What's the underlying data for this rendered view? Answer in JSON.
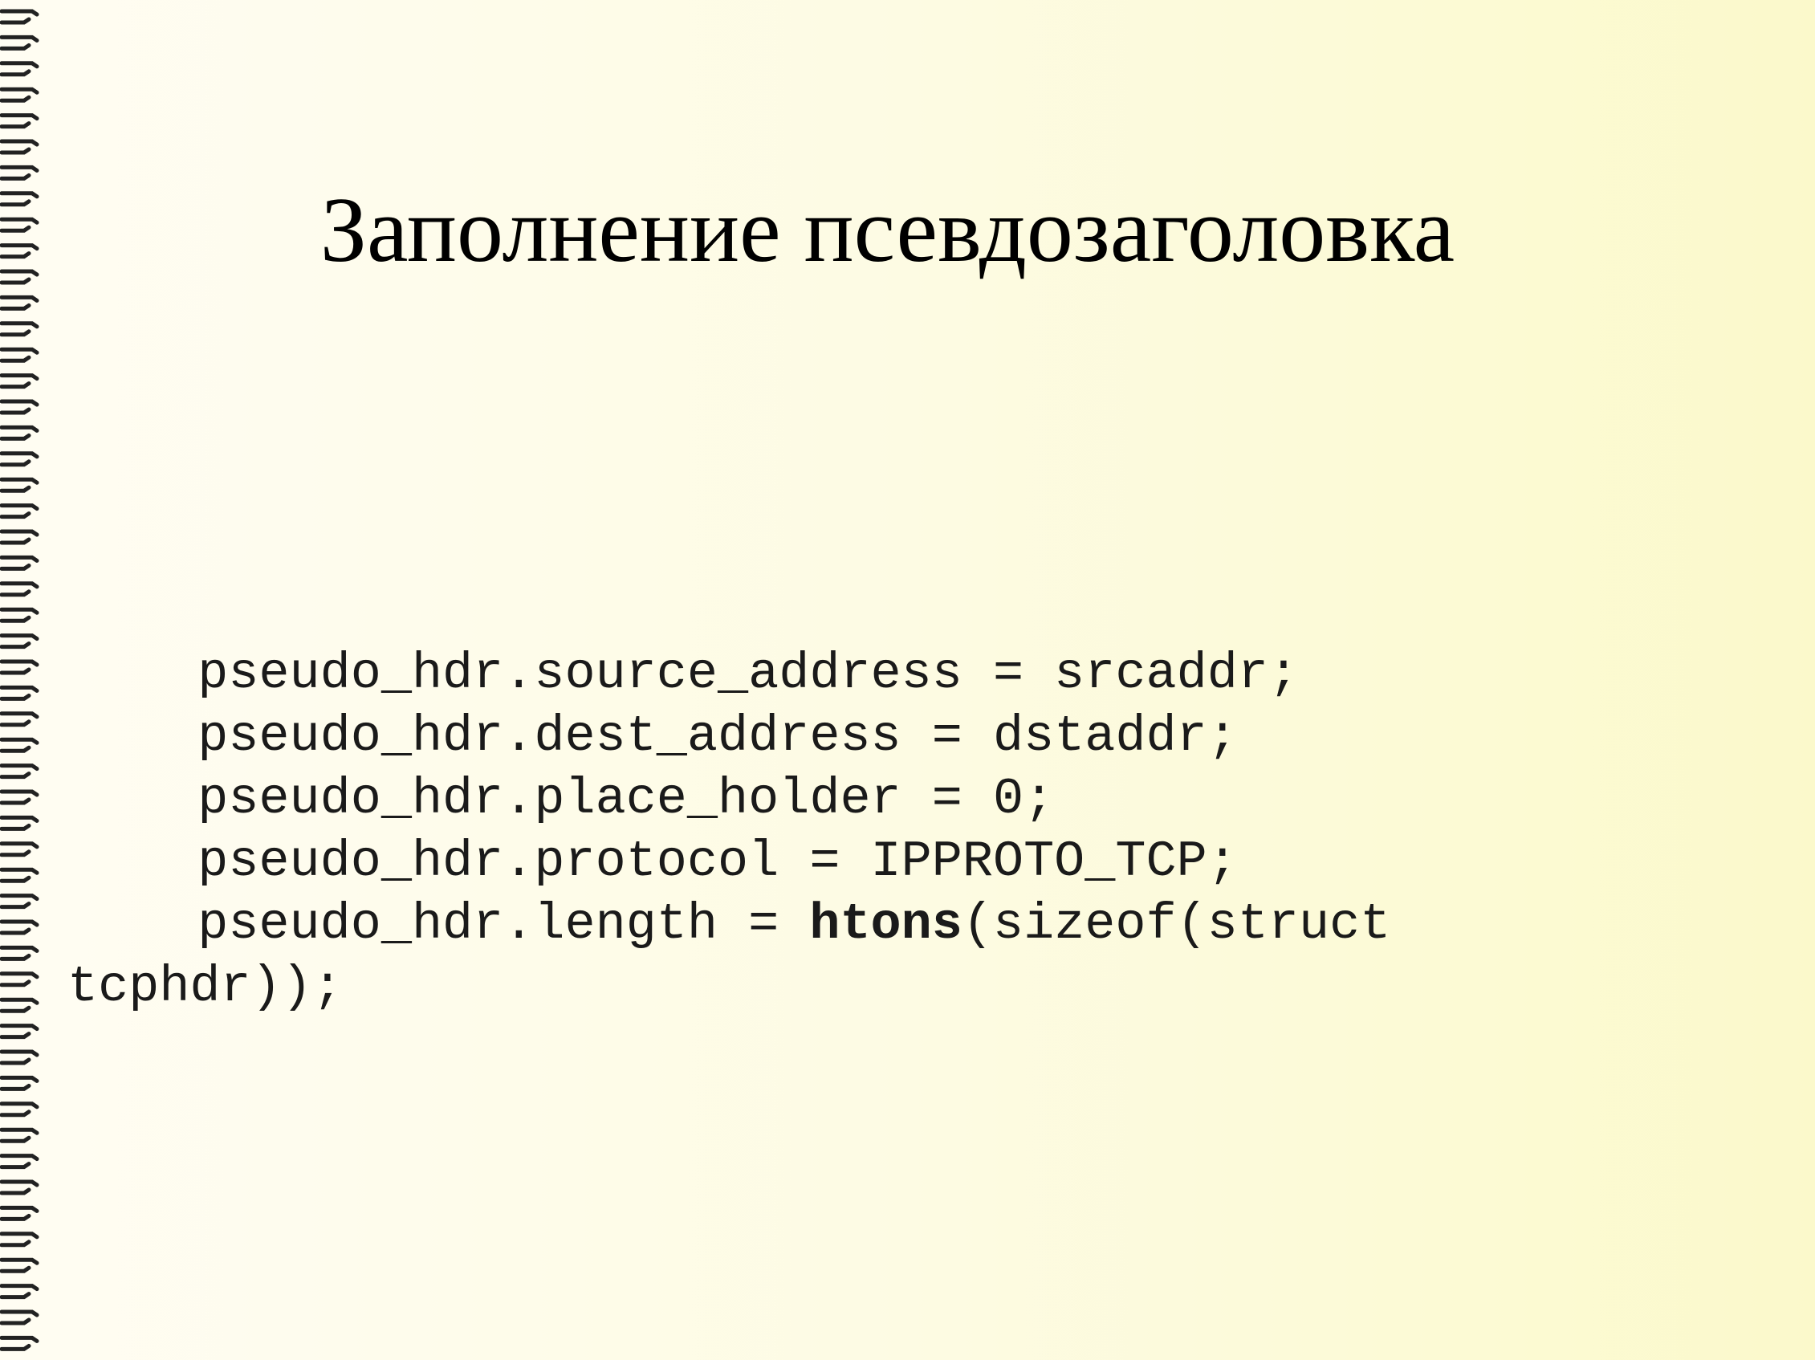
{
  "slide": {
    "title": "Заполнение псевдозаголовка",
    "code_lines": [
      "  pseudo_hdr.source_address = srcaddr;",
      "  pseudo_hdr.dest_address = dstaddr;",
      "  pseudo_hdr.place_holder = 0;",
      "  pseudo_hdr.protocol = IPPROTO_TCP;"
    ],
    "last_line": {
      "before": "  pseudo_hdr.length = ",
      "bold": "htons",
      "after": "(sizeof(struct",
      "continuation": "tcphdr));"
    }
  },
  "colors": {
    "background_left": "#fffdf3",
    "background_right": "#fbf9cb",
    "binding": "#222222"
  },
  "icons": {
    "binding": "spiral-binding-icon"
  }
}
